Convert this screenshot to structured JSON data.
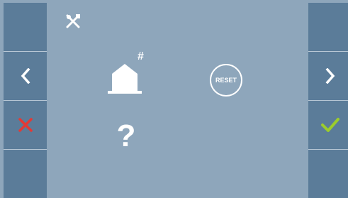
{
  "colors": {
    "background": "#8ea6bb",
    "side_panel": "#5b7c99",
    "divider": "#b9c8d6",
    "cancel": "#e53935",
    "accept": "#9ccc2c",
    "icon": "#ffffff"
  },
  "left_panel": {
    "icons": [
      "",
      "chevron-left-icon",
      "cancel-x-icon",
      ""
    ]
  },
  "right_panel": {
    "icons": [
      "",
      "chevron-right-icon",
      "check-icon",
      ""
    ]
  },
  "main": {
    "tools_icon": "tools-icon",
    "home_icon": "home-icon",
    "home_badge": "#",
    "reset_label": "RESET",
    "help_label": "?"
  }
}
